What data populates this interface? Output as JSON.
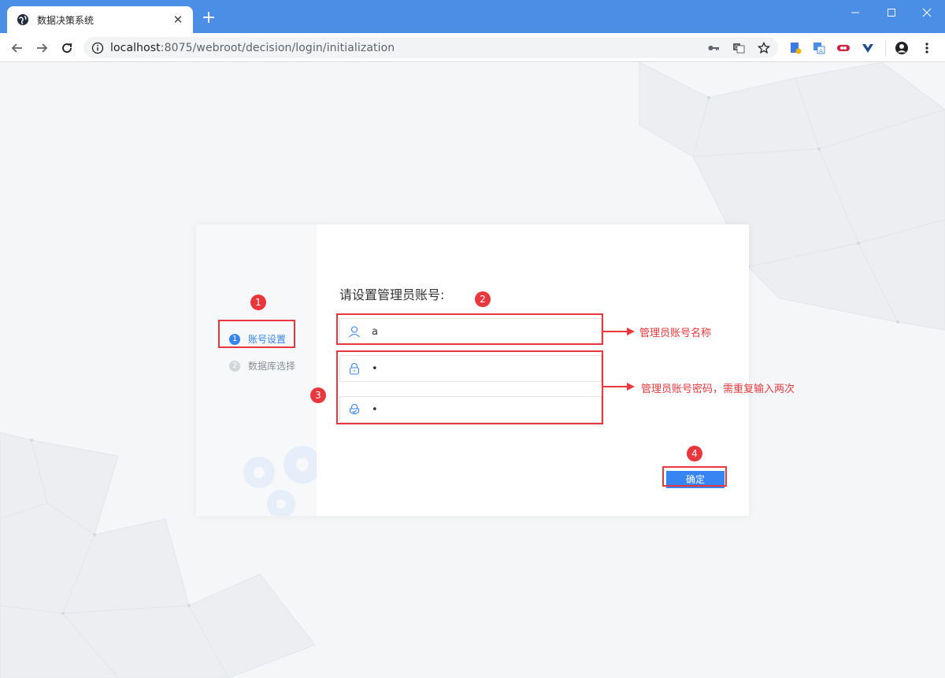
{
  "browser": {
    "tab_title": "数据决策系统",
    "tab_close": "✕",
    "new_tab": "+",
    "url_host": "localhost",
    "url_rest": ":8075/webroot/decision/login/initialization"
  },
  "steps": [
    {
      "num": "1",
      "label": "账号设置"
    },
    {
      "num": "2",
      "label": "数据库选择"
    }
  ],
  "form": {
    "title": "请设置管理员账号:",
    "username_value": "a",
    "password_value": "•",
    "password_confirm_value": "•",
    "confirm_label": "确定"
  },
  "annotations": {
    "badges": [
      "1",
      "2",
      "3",
      "4"
    ],
    "note_name": "管理员账号名称",
    "note_password": "管理员账号密码，需重复输入两次"
  },
  "colors": {
    "accent": "#3685f2",
    "annotation": "#e8383d",
    "titlebar": "#4a8ee6"
  }
}
